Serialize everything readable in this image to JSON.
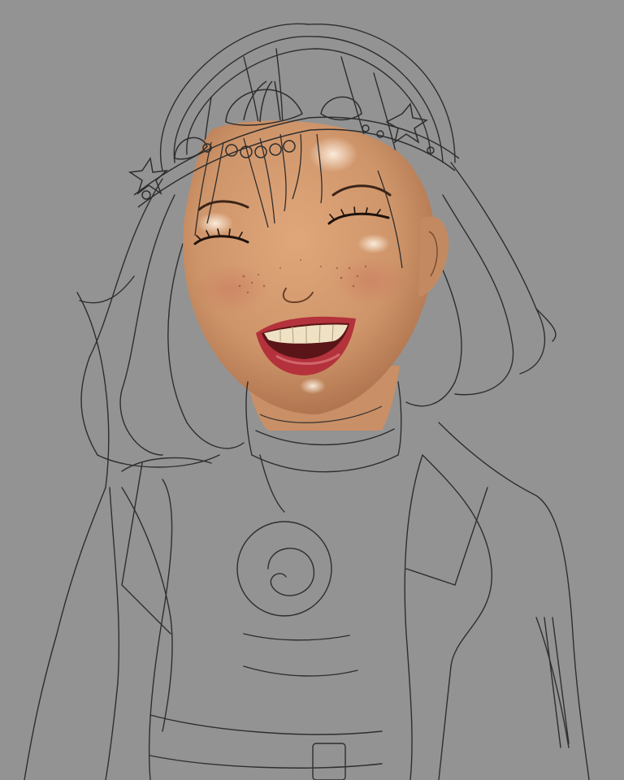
{
  "artwork": {
    "background_color": "#939393",
    "skin_color": "#d29a6f",
    "line_color": "#2e2e2e",
    "lip_color": "#b4323c",
    "teeth_color": "#efe2c4"
  }
}
